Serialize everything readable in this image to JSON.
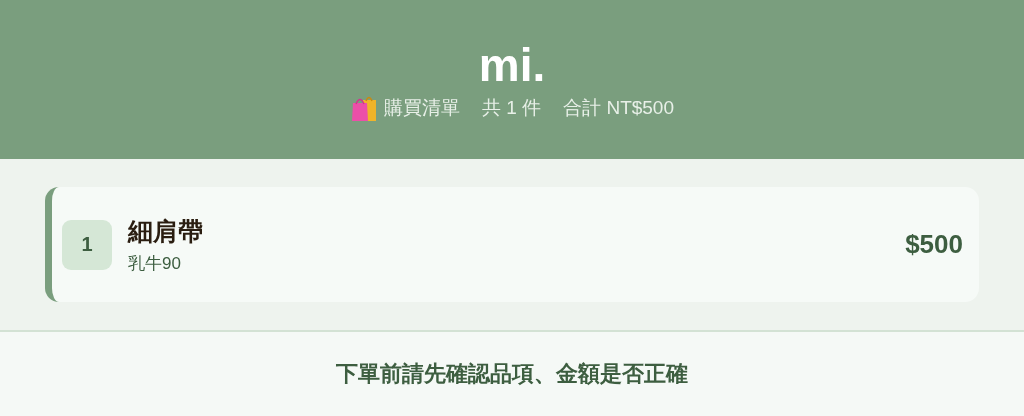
{
  "header": {
    "title": "mi.",
    "summary": [
      {
        "kind": "list",
        "text": "購買清單"
      },
      {
        "kind": "count",
        "text": "共 1 件"
      },
      {
        "kind": "total",
        "text": "合計 NT$500"
      }
    ]
  },
  "items": [
    {
      "index": "1",
      "name": "細肩帶",
      "variant": "乳牛90",
      "price": "$500"
    }
  ],
  "footer": {
    "notice": "下單前請先確認品項、金額是否正確"
  }
}
